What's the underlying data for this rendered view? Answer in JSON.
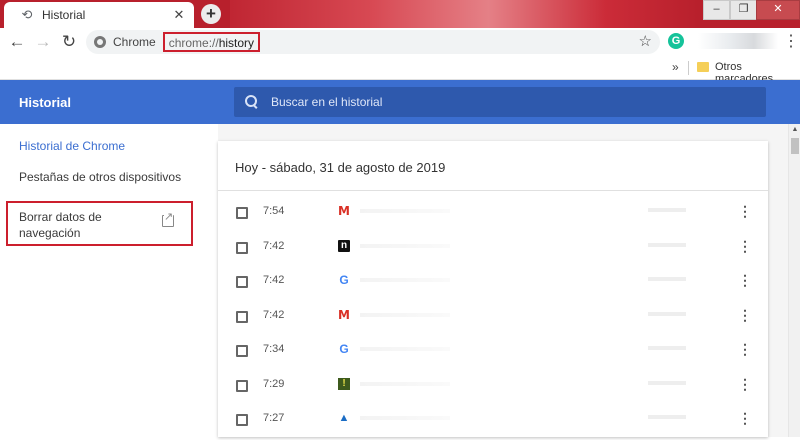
{
  "tab": {
    "icon": "history-icon",
    "title": "Historial"
  },
  "toolbar": {
    "chip": "Chrome",
    "url_scheme": "chrome://",
    "url_path": "history",
    "extension_letter": "G"
  },
  "bookmarks": {
    "overflow": "»",
    "folder_label": "Otros marcadores"
  },
  "history": {
    "title": "Historial",
    "search_placeholder": "Buscar en el historial",
    "day_header": "Hoy - sábado, 31 de agosto de 2019"
  },
  "sidebar": {
    "items": [
      {
        "label": "Historial de Chrome"
      },
      {
        "label": "Pestañas de otros dispositivos"
      }
    ],
    "clear_label": "Borrar datos de navegación"
  },
  "entries": [
    {
      "time": "7:54",
      "icon": "gmail-icon",
      "glyph": "M"
    },
    {
      "time": "7:42",
      "icon": "n-site-icon",
      "glyph": "n"
    },
    {
      "time": "7:42",
      "icon": "google-icon",
      "glyph": "G"
    },
    {
      "time": "7:42",
      "icon": "gmail-icon",
      "glyph": "M"
    },
    {
      "time": "7:34",
      "icon": "google-icon",
      "glyph": "G"
    },
    {
      "time": "7:29",
      "icon": "warning-site-icon",
      "glyph": "!"
    },
    {
      "time": "7:27",
      "icon": "mountain-site-icon",
      "glyph": "▲"
    }
  ],
  "colors": {
    "header_blue": "#3b6ed0",
    "highlight_red": "#cc1f2d",
    "titlebar_red": "#b8202c"
  }
}
